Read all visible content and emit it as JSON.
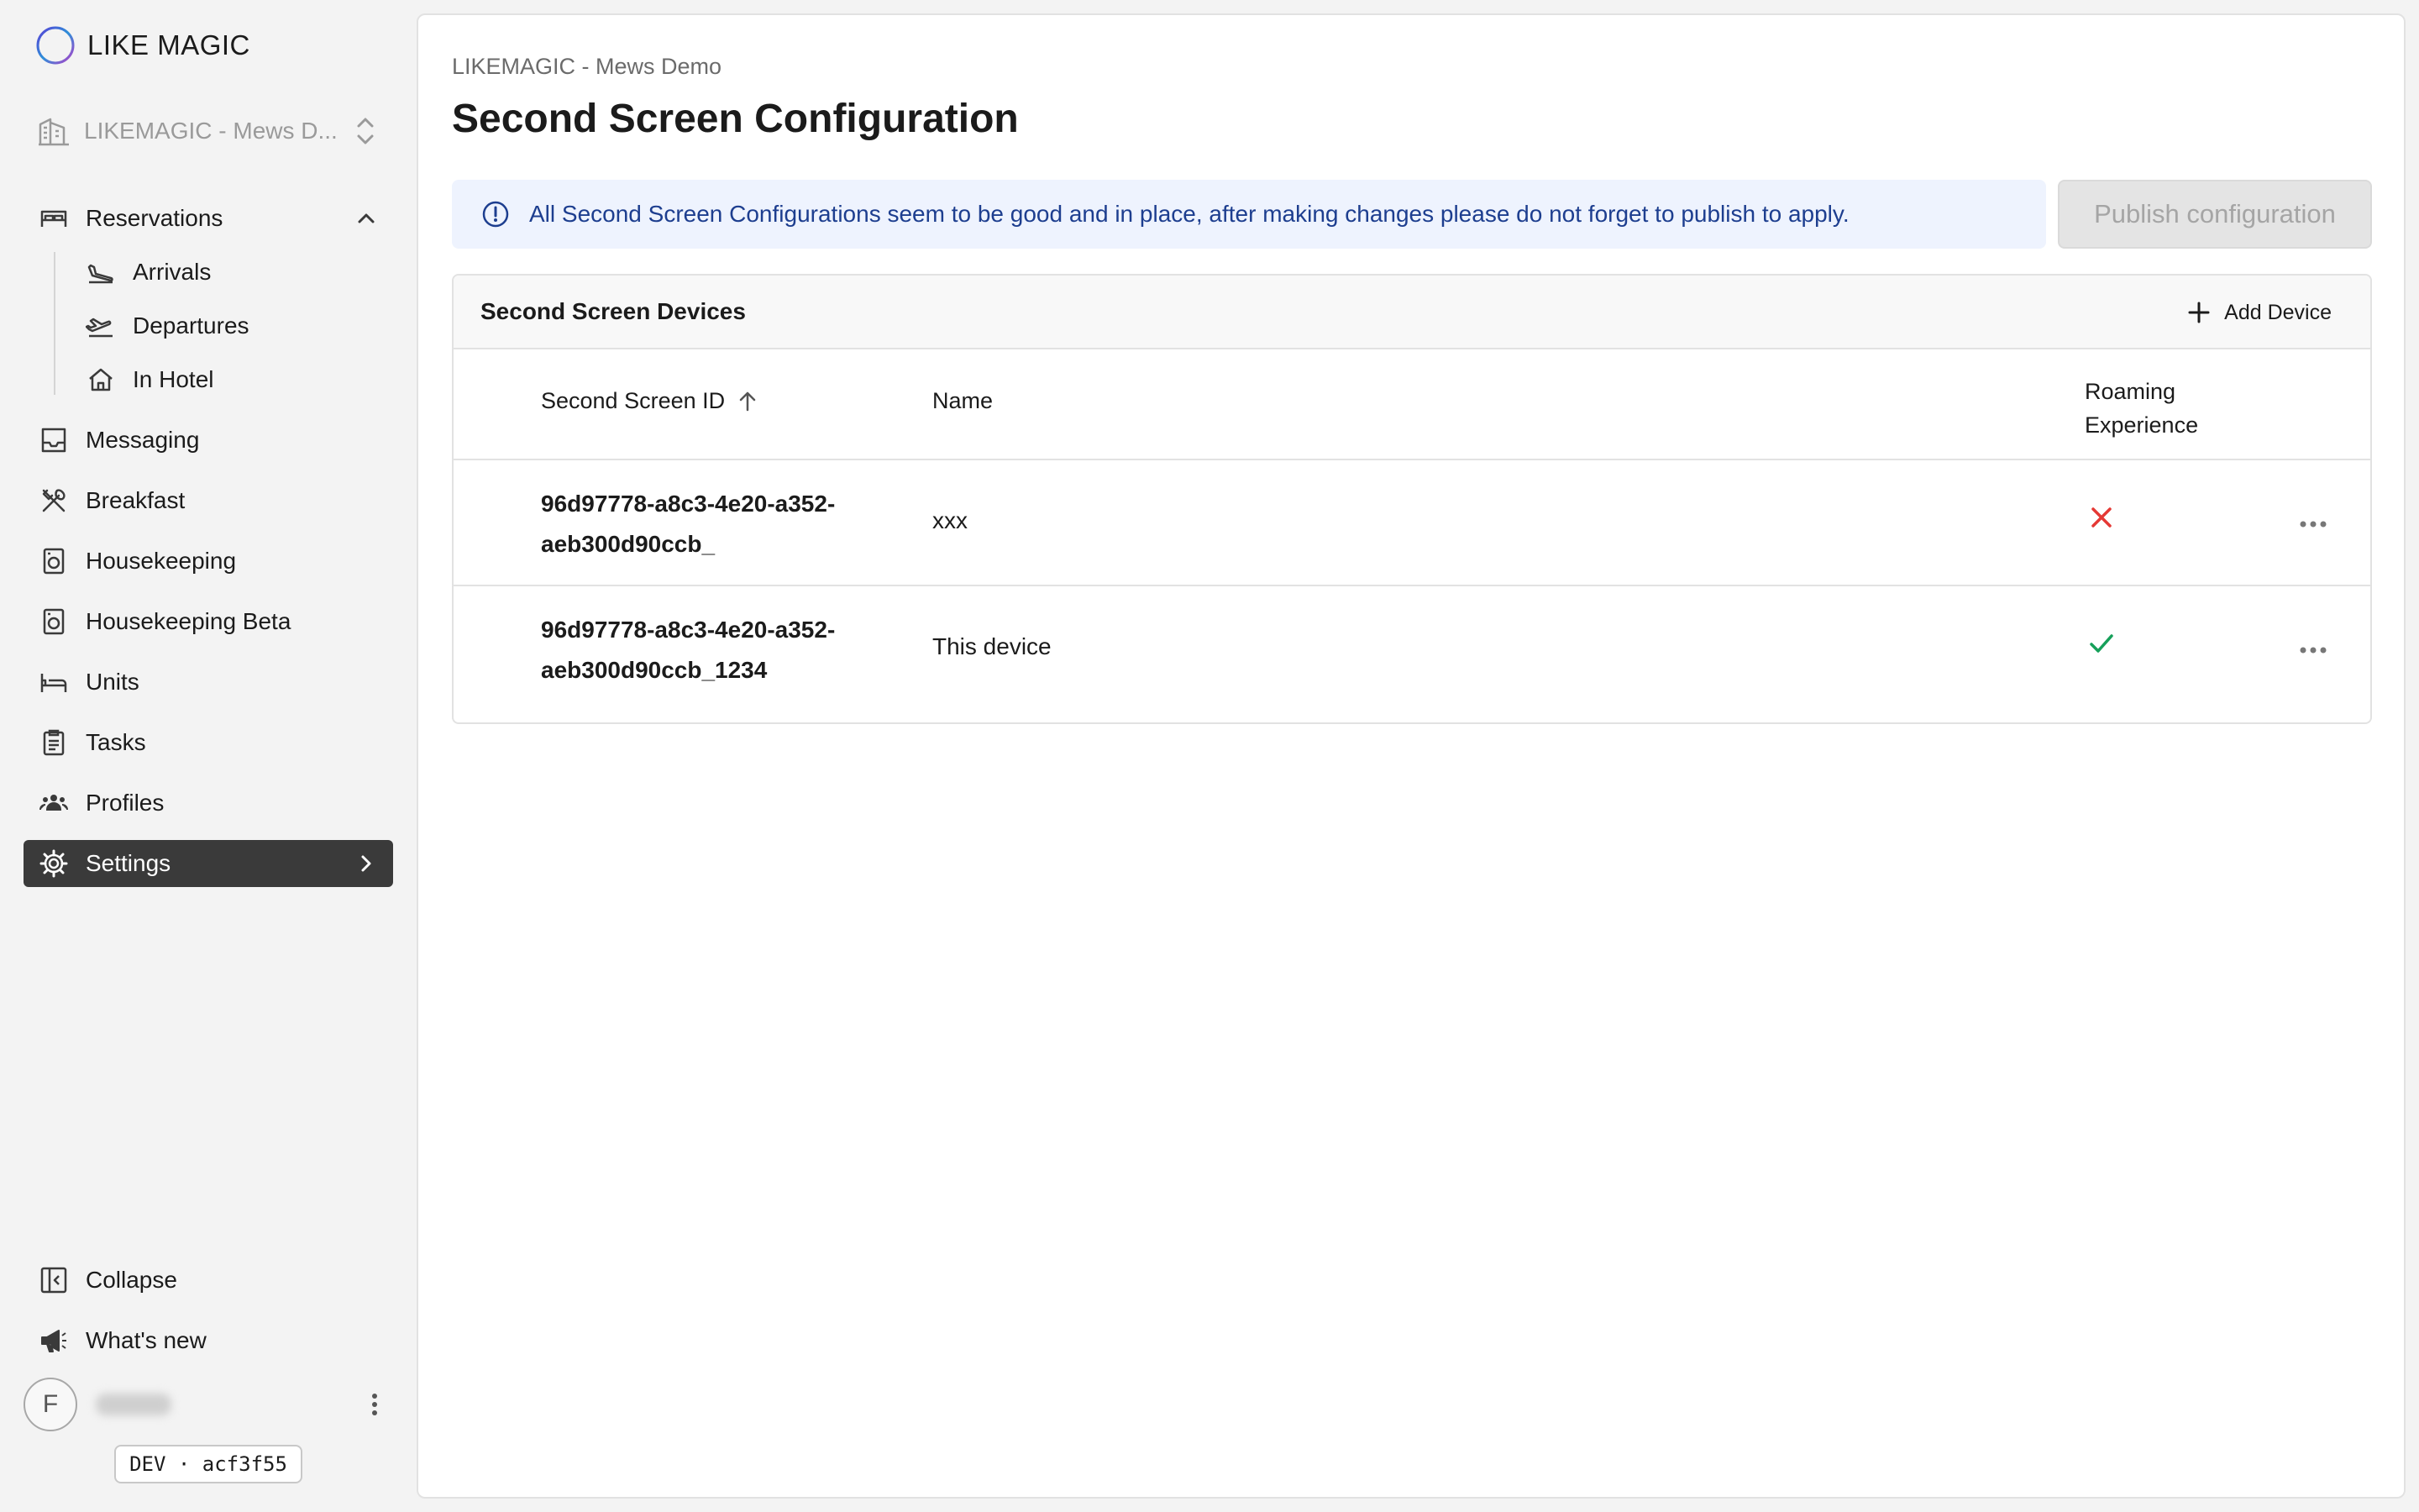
{
  "app": {
    "brand": "LIKE MAGIC",
    "property": "LIKEMAGIC - Mews D...",
    "accent": "#3a3a3a",
    "info_color": "#1d3e8f",
    "error_color": "#e53935",
    "success_color": "#16a05a"
  },
  "sidebar": {
    "items": [
      {
        "label": "Reservations",
        "icon": "bed-icon"
      },
      {
        "label": "Arrivals",
        "icon": "plane-landing-icon"
      },
      {
        "label": "Departures",
        "icon": "plane-takeoff-icon"
      },
      {
        "label": "In Hotel",
        "icon": "home-icon"
      },
      {
        "label": "Messaging",
        "icon": "inbox-icon"
      },
      {
        "label": "Breakfast",
        "icon": "utensils-icon"
      },
      {
        "label": "Housekeeping",
        "icon": "washing-machine-icon"
      },
      {
        "label": "Housekeeping Beta",
        "icon": "washing-machine-icon"
      },
      {
        "label": "Units",
        "icon": "bed-unit-icon"
      },
      {
        "label": "Tasks",
        "icon": "clipboard-icon"
      },
      {
        "label": "Profiles",
        "icon": "users-icon"
      },
      {
        "label": "Settings",
        "icon": "gear-icon"
      }
    ],
    "bottom": [
      {
        "label": "Collapse",
        "icon": "collapse-icon"
      },
      {
        "label": "What's new",
        "icon": "megaphone-icon"
      }
    ],
    "user_initial": "F",
    "env_badge": "DEV · acf3f55"
  },
  "main": {
    "breadcrumb": "LIKEMAGIC - Mews Demo",
    "title": "Second Screen Configuration",
    "alert": "All Second Screen Configurations seem to be good and in place, after making changes please do not forget to publish to apply.",
    "publish_label": "Publish configuration",
    "panel": {
      "title": "Second Screen Devices",
      "add_label": "Add Device",
      "columns": [
        "Second Screen ID",
        "Name",
        "Roaming Experience"
      ],
      "rows": [
        {
          "id": "96d97778-a8c3-4e20-a352-aeb300d90ccb_",
          "name": "xxx",
          "roaming": false
        },
        {
          "id": "96d97778-a8c3-4e20-a352-aeb300d90ccb_1234",
          "name": "This device",
          "roaming": true
        }
      ]
    }
  }
}
